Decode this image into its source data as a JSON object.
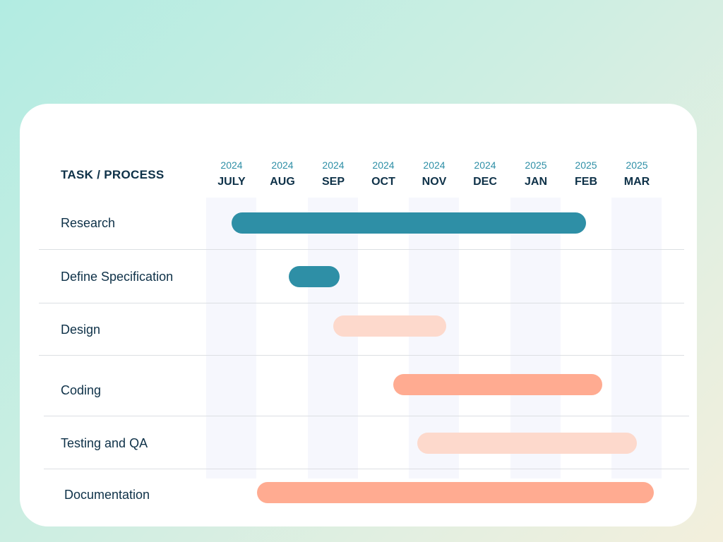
{
  "header": {
    "title": "TASK / PROCESS"
  },
  "months": [
    {
      "year": "2024",
      "name": "JULY"
    },
    {
      "year": "2024",
      "name": "AUG"
    },
    {
      "year": "2024",
      "name": "SEP"
    },
    {
      "year": "2024",
      "name": "OCT"
    },
    {
      "year": "2024",
      "name": "NOV"
    },
    {
      "year": "2024",
      "name": "DEC"
    },
    {
      "year": "2025",
      "name": "JAN"
    },
    {
      "year": "2025",
      "name": "FEB"
    },
    {
      "year": "2025",
      "name": "MAR"
    }
  ],
  "tasks": [
    {
      "label": "Research",
      "color": "#2e8fa6"
    },
    {
      "label": "Define Specification",
      "color": "#2e8fa6"
    },
    {
      "label": "Design",
      "color": "#fdd9cc"
    },
    {
      "label": "Coding",
      "color": "#ffab91"
    },
    {
      "label": "Testing and QA",
      "color": "#fdd9cc"
    },
    {
      "label": "Documentation",
      "color": "#ffab91"
    }
  ],
  "colors": {
    "primary": "#2e8fa6",
    "dark_text": "#0e3148",
    "coral": "#ffab91",
    "light_coral": "#fdd9cc",
    "stripe": "#f6f7fd"
  }
}
